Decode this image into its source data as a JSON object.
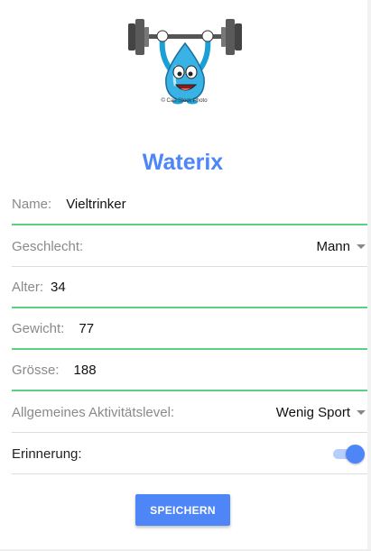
{
  "logo": {
    "caption": "© Can Stock Photo"
  },
  "app_title": "Waterix",
  "form": {
    "name": {
      "label": "Name:",
      "value": "Vieltrinker"
    },
    "gender": {
      "label": "Geschlecht:",
      "value": "Mann"
    },
    "age": {
      "label": "Alter:",
      "value": "34"
    },
    "weight": {
      "label": "Gewicht:",
      "value": "77"
    },
    "height": {
      "label": "Grösse:",
      "value": "188"
    },
    "activity": {
      "label": "Allgemeines Aktivitätslevel:",
      "value": "Wenig Sport"
    },
    "reminder": {
      "label": "Erinnerung:",
      "enabled": true
    }
  },
  "save_label": "SPEICHERN",
  "colors": {
    "accent": "#4f86f7",
    "valid_line": "#5ccf82",
    "divider": "#dddddd"
  },
  "icons": {
    "logo": "water-drop-weightlifter",
    "dropdown": "caret-down-icon"
  }
}
